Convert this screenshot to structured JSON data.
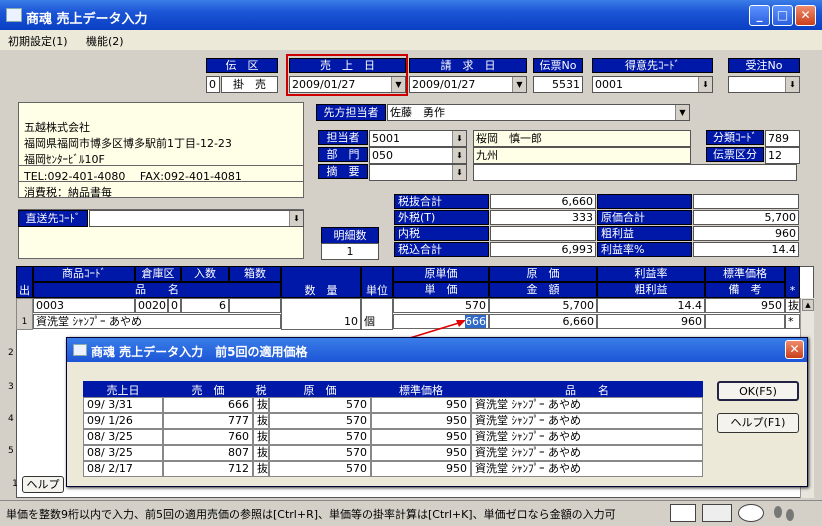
{
  "window": {
    "title": "商魂 売上データ入力",
    "min": "_",
    "max": "□",
    "close": "✕"
  },
  "menu": {
    "item1": "初期設定(1)",
    "item2": "機能(2)"
  },
  "header": {
    "denku_label": "伝　区",
    "denku_code": "0",
    "denku_value": "掛　売",
    "uriage_label": "売　上　日",
    "uriage_value": "2009/01/27",
    "seikyu_label": "請　求　日",
    "seikyu_value": "2009/01/27",
    "denpyo_label": "伝票No",
    "denpyo_value": "5531",
    "tokui_label": "得意先ｺｰﾄﾞ",
    "tokui_value": "0001",
    "juchu_label": "受注No",
    "juchu_value": ""
  },
  "customer": {
    "name": "五越株式会社",
    "addr1": "福岡県福岡市博多区博多駅前1丁目-12-23",
    "addr2": "福岡ｾﾝﾀｰﾋﾞﾙ10F",
    "tel": "TEL:092-401-4080　 FAX:092-401-4081",
    "tax": "消費税：納品書毎"
  },
  "contact": {
    "label": "先方担当者",
    "value": "佐藤　勇作"
  },
  "tanto": {
    "label": "担当者",
    "code": "5001",
    "name": "桜岡　慎一郎"
  },
  "bumon": {
    "label": "部　門",
    "code": "050",
    "name": "九州"
  },
  "tekiyo": {
    "label": "摘　要",
    "value": ""
  },
  "bunrui": {
    "label": "分類ｺｰﾄﾞ",
    "value": "789"
  },
  "denpyo_kubun": {
    "label": "伝票区分",
    "value": "12"
  },
  "chokuso": {
    "label": "直送先ｺｰﾄﾞ",
    "value": ""
  },
  "meisai": {
    "label": "明細数",
    "value": "1"
  },
  "totals": {
    "zeinuki_label": "税抜合計",
    "zeinuki": "6,660",
    "sotozei_label": "外税(T)",
    "sotozei": "333",
    "genka_label": "原価合計",
    "genka": "5,700",
    "uchizei_label": "内税",
    "uchizei": "",
    "arari_label": "粗利益",
    "arari": "960",
    "zeikomi_label": "税込合計",
    "zeikomi": "6,993",
    "arariritsu_label": "利益率%",
    "arariritsu": "14.4"
  },
  "grid": {
    "h_shohin": "商品ｺｰﾄﾞ",
    "h_soko": "倉庫区",
    "h_irisu": "入数",
    "h_hakosu": "箱数",
    "h_hinmei": "品　　名",
    "h_deru": "出",
    "h_suryo": "数　量",
    "h_tani": "単位",
    "h_gentanka": "原単価",
    "h_tanka": "単　価",
    "h_genka": "原　価",
    "h_kingaku": "金　額",
    "h_riekiritsu": "利益率",
    "h_arari": "粗利益",
    "h_hyojun": "標準価格",
    "h_biko": "備　考",
    "h_ast": "*",
    "row": {
      "no": "1",
      "code": "0003",
      "soko": "0020",
      "kubun": "0",
      "irisu": "6",
      "hinmei": "資洗堂 ｼｬﾝﾌﾟｰ あやめ",
      "suryo": "10",
      "tani": "個",
      "gentanka": "570",
      "tanka": "666",
      "genka": "5,700",
      "kingaku": "6,660",
      "riekiritsu": "14.4",
      "arari": "960",
      "hyojun": "950",
      "nuki": "抜",
      "ast": "*"
    },
    "rownums": [
      "2",
      "3",
      "4",
      "5"
    ]
  },
  "modal": {
    "title": "商魂 売上データ入力　前5回の適用価格",
    "h_date": "売上日",
    "h_price": "売　価",
    "h_zei": "税",
    "h_cost": "原　価",
    "h_std": "標準価格",
    "h_name": "品　　名",
    "ok": "OK(F5)",
    "help": "ヘルプ(F1)",
    "rows": [
      {
        "date": "09/ 3/31",
        "price": "666",
        "zei": "抜",
        "cost": "570",
        "std": "950",
        "name": "資洗堂 ｼｬﾝﾌﾟｰ あやめ"
      },
      {
        "date": "09/ 1/26",
        "price": "777",
        "zei": "抜",
        "cost": "570",
        "std": "950",
        "name": "資洗堂 ｼｬﾝﾌﾟｰ あやめ"
      },
      {
        "date": "08/ 3/25",
        "price": "760",
        "zei": "抜",
        "cost": "570",
        "std": "950",
        "name": "資洗堂 ｼｬﾝﾌﾟｰ あやめ"
      },
      {
        "date": "08/ 3/25",
        "price": "807",
        "zei": "抜",
        "cost": "570",
        "std": "950",
        "name": "資洗堂 ｼｬﾝﾌﾟｰ あやめ"
      },
      {
        "date": "08/ 2/17",
        "price": "712",
        "zei": "抜",
        "cost": "570",
        "std": "950",
        "name": "資洗堂 ｼｬﾝﾌﾟｰ あやめ"
      }
    ]
  },
  "bottom": {
    "page": "1",
    "help": "ヘルプ"
  },
  "status": {
    "text": "単価を整数9桁以内で入力、前5回の適用売価の参照は[Ctrl+R]、単価等の掛率計算は[Ctrl+K]、単価ゼロなら金額の入力可"
  },
  "colors": {
    "header_blue": "#0018a8",
    "title_blue": "#1c55d6",
    "highlight_red": "#cc0000"
  }
}
